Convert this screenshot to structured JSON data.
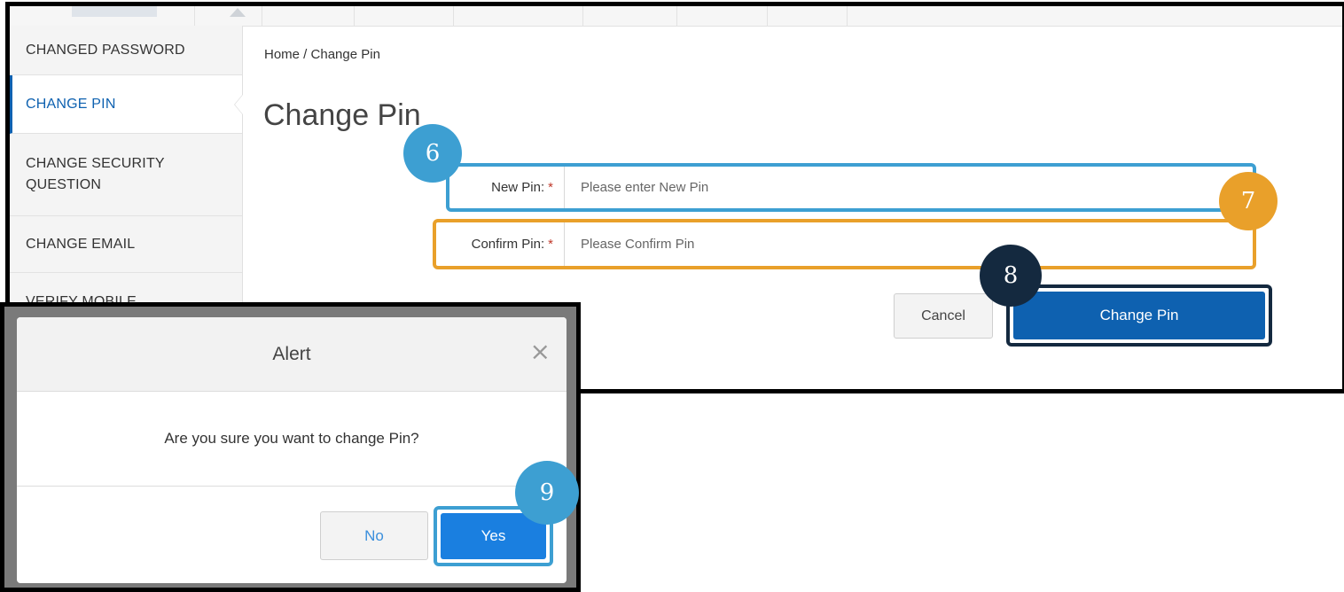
{
  "sidebar": {
    "items": [
      {
        "label": "CHANGED PASSWORD",
        "active": false
      },
      {
        "label": "CHANGE PIN",
        "active": true
      },
      {
        "label": "CHANGE SECURITY QUESTION",
        "active": false
      },
      {
        "label": "CHANGE EMAIL",
        "active": false
      },
      {
        "label": "VERIFY MOBILE",
        "active": false
      }
    ]
  },
  "breadcrumb": "Home / Change Pin",
  "page_title": "Change Pin",
  "form": {
    "new_pin": {
      "label": "New Pin:",
      "required_mark": "*",
      "placeholder": "Please enter New Pin",
      "value": ""
    },
    "confirm_pin": {
      "label": "Confirm Pin:",
      "required_mark": "*",
      "placeholder": "Please Confirm Pin",
      "value": ""
    },
    "cancel_label": "Cancel",
    "submit_label": "Change Pin"
  },
  "callouts": {
    "c6": "6",
    "c7": "7",
    "c8": "8",
    "c9": "9"
  },
  "alert": {
    "title": "Alert",
    "close_glyph": "×",
    "message": "Are you sure you want to change Pin?",
    "no_label": "No",
    "yes_label": "Yes"
  },
  "colors": {
    "primary": "#0e61b0",
    "callout_blue": "#3d9fd2",
    "callout_orange": "#e9a02a",
    "callout_navy": "#14293f",
    "required": "#c0392b"
  }
}
